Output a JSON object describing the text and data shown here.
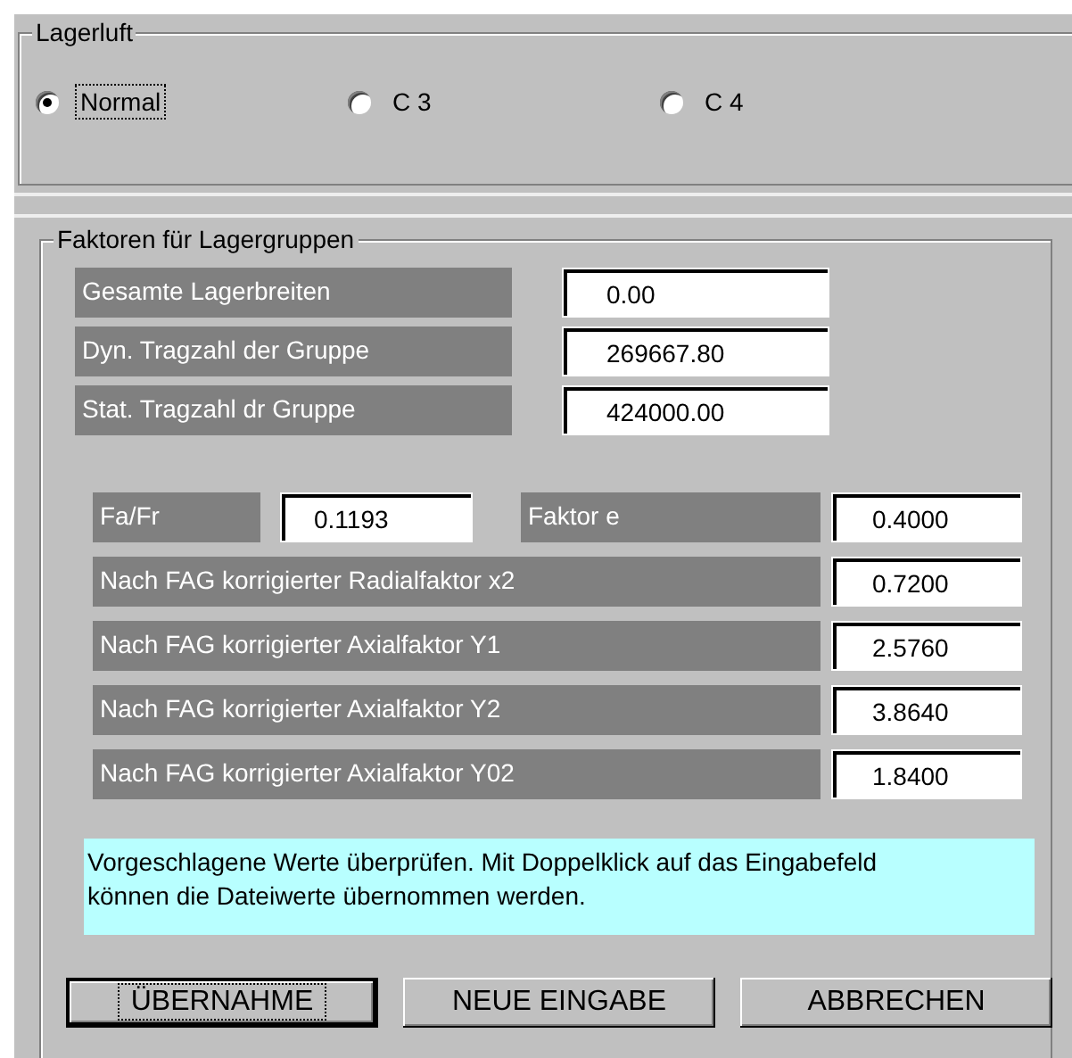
{
  "clearance_group": {
    "title": "Lagerluft",
    "options": [
      {
        "label": "Normal",
        "selected": true
      },
      {
        "label": "C 3",
        "selected": false
      },
      {
        "label": "C 4",
        "selected": false
      }
    ]
  },
  "factors_group": {
    "title": "Faktoren für Lagergruppen",
    "group_fields": [
      {
        "label": "Gesamte Lagerbreiten",
        "value": "0.00"
      },
      {
        "label": "Dyn. Tragzahl der Gruppe",
        "value": "269667.80"
      },
      {
        "label": "Stat. Tragzahl dr Gruppe",
        "value": "424000.00"
      }
    ],
    "ratio": {
      "label": "Fa/Fr",
      "value": "0.1193"
    },
    "factor_e": {
      "label": "Faktor e",
      "value": "0.4000"
    },
    "corrected_factors": [
      {
        "label": "Nach FAG korrigierter Radialfaktor  x2",
        "value": "0.7200"
      },
      {
        "label": "Nach FAG korrigierter Axialfaktor Y1",
        "value": "2.5760"
      },
      {
        "label": "Nach FAG korrigierter Axialfaktor Y2",
        "value": "3.8640"
      },
      {
        "label": "Nach FAG korrigierter Axialfaktor Y02",
        "value": "1.8400"
      }
    ],
    "hint": "Vorgeschlagene Werte überprüfen. Mit Doppelklick auf das Eingabefeld können die Dateiwerte übernommen werden.",
    "buttons": [
      {
        "label": "ÜBERNAHME",
        "focused": true
      },
      {
        "label": "NEUE EINGABE",
        "focused": false
      },
      {
        "label": "ABBRECHEN",
        "focused": false
      }
    ]
  }
}
